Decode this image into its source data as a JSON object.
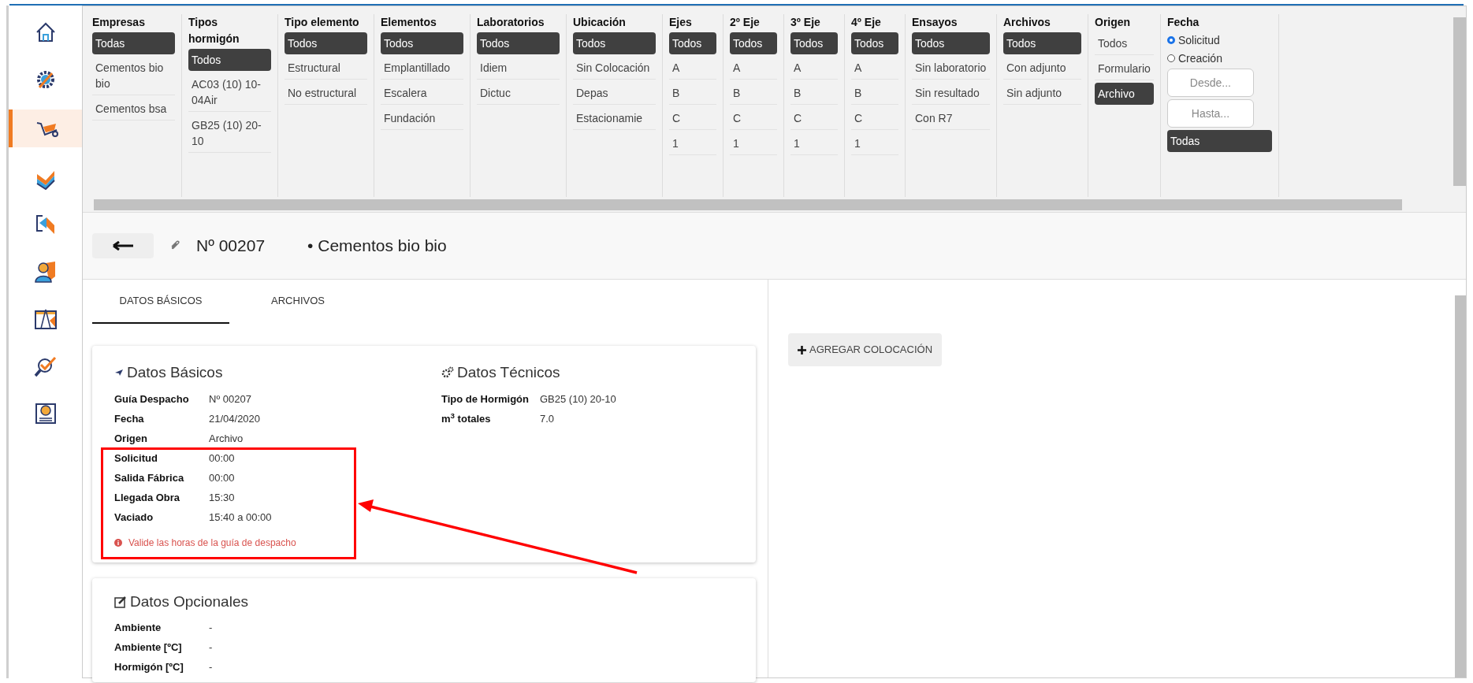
{
  "sidebar": {
    "items": [
      {
        "selected": false
      },
      {
        "selected": false
      },
      {
        "selected": true
      },
      {
        "selected": false
      },
      {
        "selected": false
      },
      {
        "selected": false
      },
      {
        "selected": false
      },
      {
        "selected": false
      },
      {
        "selected": false
      }
    ]
  },
  "filters": [
    {
      "kind": "list",
      "title": "Empresas",
      "options": [
        {
          "label": "Todas",
          "selected": true
        },
        {
          "label": "Cementos bio bio",
          "selected": false
        },
        {
          "label": "Cementos bsa",
          "selected": false
        }
      ]
    },
    {
      "kind": "list",
      "title": "Tipos hormigón",
      "options": [
        {
          "label": "Todos",
          "selected": true
        },
        {
          "label": "AC03 (10) 10-04Air",
          "selected": false
        },
        {
          "label": "GB25 (10) 20-10",
          "selected": false
        }
      ]
    },
    {
      "kind": "list",
      "title": "Tipo elemento",
      "options": [
        {
          "label": "Todos",
          "selected": true
        },
        {
          "label": "Estructural",
          "selected": false
        },
        {
          "label": "No estructural",
          "selected": false
        }
      ]
    },
    {
      "kind": "list",
      "title": "Elementos",
      "options": [
        {
          "label": "Todos",
          "selected": true
        },
        {
          "label": "Emplantillado",
          "selected": false
        },
        {
          "label": "Escalera",
          "selected": false
        },
        {
          "label": "Fundación",
          "selected": false
        }
      ]
    },
    {
      "kind": "list",
      "title": "Laboratorios",
      "options": [
        {
          "label": "Todos",
          "selected": true
        },
        {
          "label": "Idiem",
          "selected": false
        },
        {
          "label": "Dictuc",
          "selected": false
        }
      ]
    },
    {
      "kind": "list",
      "title": "Ubicación",
      "options": [
        {
          "label": "Todos",
          "selected": true
        },
        {
          "label": "Sin Colocación",
          "selected": false
        },
        {
          "label": "Depas",
          "selected": false
        },
        {
          "label": "Estacionamie",
          "selected": false
        }
      ]
    },
    {
      "kind": "list",
      "title": "Ejes",
      "options": [
        {
          "label": "Todos",
          "selected": true
        },
        {
          "label": "A",
          "selected": false
        },
        {
          "label": "B",
          "selected": false
        },
        {
          "label": "C",
          "selected": false
        },
        {
          "label": "1",
          "selected": false
        }
      ]
    },
    {
      "kind": "list",
      "title": "2º Eje",
      "options": [
        {
          "label": "Todos",
          "selected": true
        },
        {
          "label": "A",
          "selected": false
        },
        {
          "label": "B",
          "selected": false
        },
        {
          "label": "C",
          "selected": false
        },
        {
          "label": "1",
          "selected": false
        }
      ]
    },
    {
      "kind": "list",
      "title": "3º Eje",
      "options": [
        {
          "label": "Todos",
          "selected": true
        },
        {
          "label": "A",
          "selected": false
        },
        {
          "label": "B",
          "selected": false
        },
        {
          "label": "C",
          "selected": false
        },
        {
          "label": "1",
          "selected": false
        }
      ]
    },
    {
      "kind": "list",
      "title": "4º Eje",
      "options": [
        {
          "label": "Todos",
          "selected": true
        },
        {
          "label": "A",
          "selected": false
        },
        {
          "label": "B",
          "selected": false
        },
        {
          "label": "C",
          "selected": false
        },
        {
          "label": "1",
          "selected": false
        }
      ]
    },
    {
      "kind": "list",
      "title": "Ensayos",
      "options": [
        {
          "label": "Todos",
          "selected": true
        },
        {
          "label": "Sin laboratorio",
          "selected": false
        },
        {
          "label": "Sin resultado",
          "selected": false
        },
        {
          "label": "Con R7",
          "selected": false
        }
      ]
    },
    {
      "kind": "list",
      "title": "Archivos",
      "options": [
        {
          "label": "Todos",
          "selected": true
        },
        {
          "label": "Con adjunto",
          "selected": false
        },
        {
          "label": "Sin adjunto",
          "selected": false
        }
      ]
    },
    {
      "kind": "list",
      "title": "Origen",
      "options": [
        {
          "label": "Todos",
          "selected": false
        },
        {
          "label": "Formulario",
          "selected": false
        },
        {
          "label": "Archivo",
          "selected": true
        }
      ]
    },
    {
      "kind": "date",
      "title": "Fecha",
      "radios": [
        {
          "label": "Solicitud",
          "selected": true
        },
        {
          "label": "Creación",
          "selected": false
        }
      ],
      "inputs": [
        {
          "placeholder": "Desde..."
        },
        {
          "placeholder": "Hasta..."
        }
      ],
      "options": [
        {
          "label": "Todas",
          "selected": true
        }
      ]
    }
  ],
  "header": {
    "number": "Nº 00207",
    "company": "• Cementos bio bio"
  },
  "tabs": [
    {
      "label": "DATOS BÁSICOS",
      "selected": true
    },
    {
      "label": "ARCHIVOS",
      "selected": false
    }
  ],
  "basic": {
    "title": "Datos Básicos",
    "rows": [
      {
        "label": "Guía Despacho",
        "value": "Nº 00207"
      },
      {
        "label": "Fecha",
        "value": "21/04/2020"
      },
      {
        "label": "Origen",
        "value": "Archivo"
      },
      {
        "label": "Solicitud",
        "value": "00:00"
      },
      {
        "label": "Salida Fábrica",
        "value": "00:00"
      },
      {
        "label": "Llegada Obra",
        "value": "15:30"
      },
      {
        "label": "Vaciado",
        "value": "15:40 a 00:00"
      }
    ],
    "warning": "Valide las horas de la guía de despacho"
  },
  "technical": {
    "title": "Datos Técnicos",
    "rows": [
      {
        "label": "Tipo de Hormigón",
        "value": "GB25 (10) 20-10"
      },
      {
        "label": "m$^{3}$ totales",
        "value": "7.0"
      }
    ]
  },
  "optional": {
    "title": "Datos Opcionales",
    "rows": [
      {
        "label": "Ambiente",
        "value": "-"
      },
      {
        "label": "Ambiente [ºC]",
        "value": "-"
      },
      {
        "label": "Hormigón [ºC]",
        "value": "-"
      }
    ]
  },
  "add_button": "AGREGAR COLOCACIÓN"
}
